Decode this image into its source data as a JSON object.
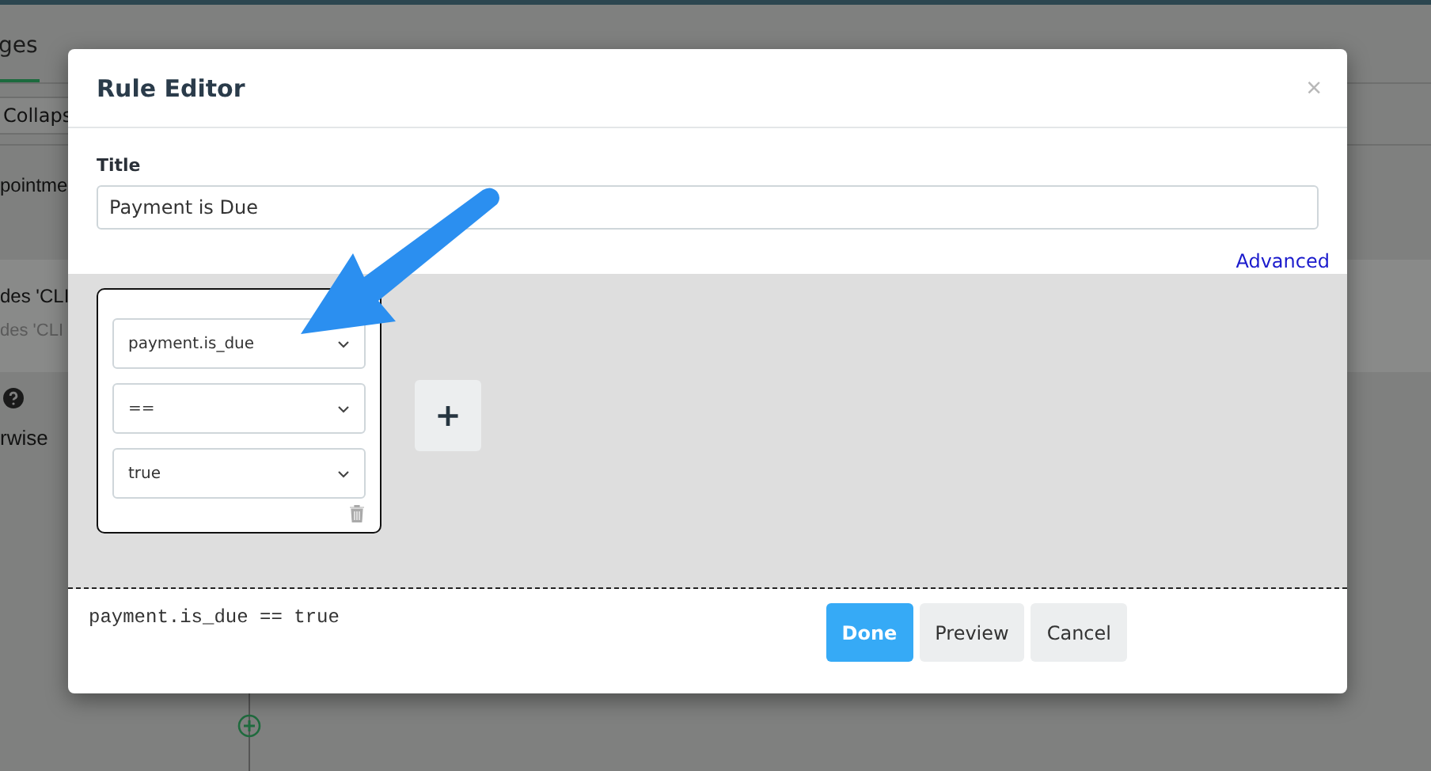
{
  "background": {
    "tabs": [
      {
        "label": "ges",
        "selected": true
      }
    ],
    "collapse_button": "Collaps",
    "items": [
      {
        "title": "pointme",
        "selected": false
      },
      {
        "title": "des 'CLI",
        "subtitle": "des 'CLI",
        "selected": true
      }
    ],
    "otherwise_label": "rwise"
  },
  "modal": {
    "title": "Rule Editor",
    "close": "×",
    "field_label": "Title",
    "field_value": "Payment is Due",
    "advanced_link": "Advanced",
    "conditions": [
      {
        "selects": [
          "payment.is_due",
          "==",
          "true"
        ]
      }
    ],
    "add_button": "+",
    "expression": "payment.is_due == true",
    "buttons": [
      {
        "label": "Done",
        "kind": "primary"
      },
      {
        "label": "Preview",
        "kind": "secondary"
      },
      {
        "label": "Cancel",
        "kind": "secondary"
      }
    ]
  }
}
